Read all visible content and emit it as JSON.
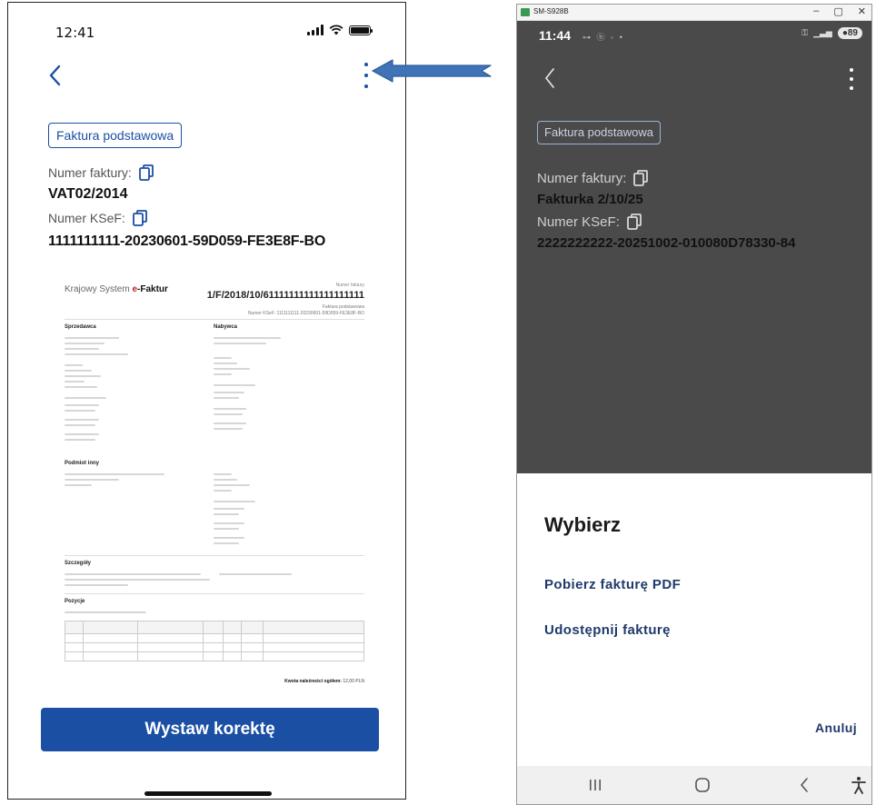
{
  "left_phone": {
    "status": {
      "time": "12:41"
    },
    "doc_type_pill": "Faktura podstawowa",
    "invoice_number_label": "Numer faktury:",
    "invoice_number": "VAT02/2014",
    "ksef_label": "Numer KSeF:",
    "ksef_number": "1111111111-20230601-59D059-FE3E8F-BO",
    "preview": {
      "brand_prefix": "Krajowy System ",
      "brand_e": "e",
      "brand_suffix": "-Faktur",
      "number_caption": "Numer faktury",
      "number": "1/F/2018/10/61111111111111111111",
      "kind": "Faktura podstawowa",
      "ksef_line": "Numer KSeF: 1111111111-20230601-59D059-FE3E8F-BO",
      "seller_heading": "Sprzedawca",
      "buyer_heading": "Nabywca",
      "other_heading": "Podmiot inny",
      "details_heading": "Szczegóły",
      "items_heading": "Pozycje",
      "total_label": "Kwota należności ogółem:",
      "total_value": "12,00 PLN"
    },
    "primary_button": "Wystaw korektę"
  },
  "right_phone": {
    "window_title": "SM-S928B",
    "window_controls": {
      "minimize": "–",
      "maximize": "▢",
      "close": "✕"
    },
    "status": {
      "time": "11:44",
      "battery": "89"
    },
    "doc_type_pill": "Faktura podstawowa",
    "invoice_number_label": "Numer faktury:",
    "invoice_number": "Fakturka 2/10/25",
    "ksef_label": "Numer KSeF:",
    "ksef_number": "2222222222-20251002-010080D78330-84",
    "sheet": {
      "title": "Wybierz",
      "items": [
        "Pobierz fakturę PDF",
        "Udostępnij fakturę"
      ],
      "cancel": "Anuluj"
    }
  },
  "colors": {
    "brand_blue": "#1a4fa3",
    "sheet_text": "#1f3a6b",
    "overlay": "#4a4a4a"
  },
  "icons": [
    "back-chevron-icon",
    "kebab-menu-icon",
    "copy-icon",
    "arrow-annotation-icon",
    "recent-apps-icon",
    "home-icon",
    "back-nav-icon",
    "accessibility-icon"
  ]
}
